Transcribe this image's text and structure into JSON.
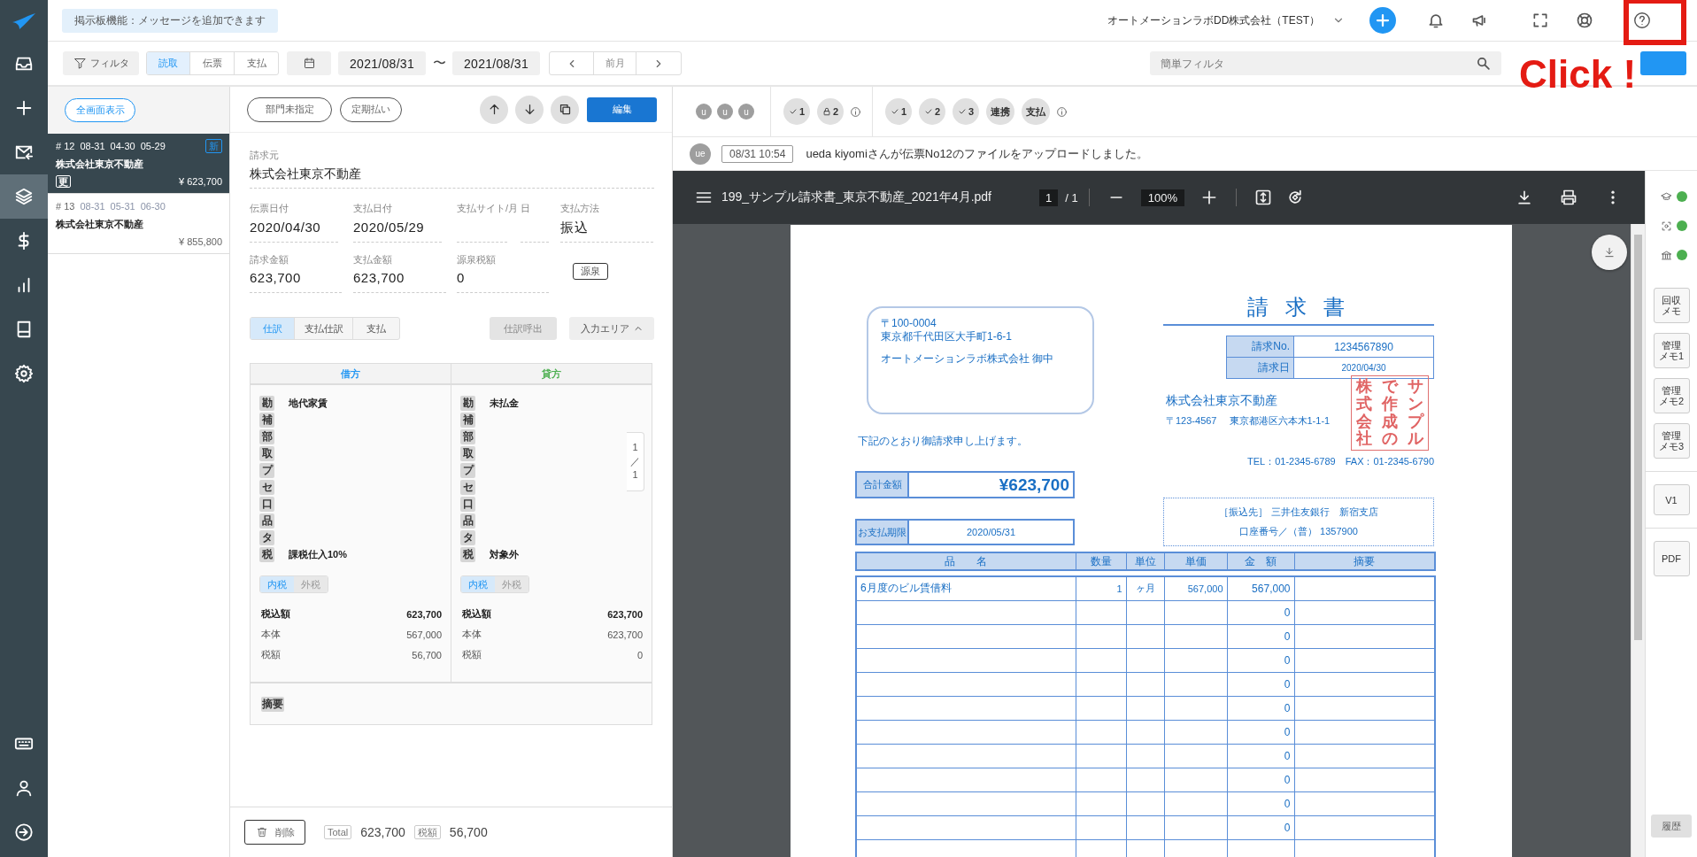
{
  "nav": {
    "top": [
      {
        "kind": "inbox",
        "selected": false
      },
      {
        "kind": "add",
        "selected": false
      },
      {
        "kind": "mail",
        "selected": false
      },
      {
        "kind": "layers",
        "selected": true
      },
      {
        "kind": "money",
        "selected": false
      },
      {
        "kind": "chart",
        "selected": false
      },
      {
        "kind": "book",
        "selected": false
      },
      {
        "kind": "settings",
        "selected": false
      }
    ],
    "bottom": [
      {
        "kind": "keyboard",
        "selected": false
      },
      {
        "kind": "user",
        "selected": false
      },
      {
        "kind": "logout",
        "selected": false
      }
    ]
  },
  "topbar": {
    "notice": "掲示板機能：メッセージを追加できます",
    "company": "オートメーションラボDD株式会社（TEST）"
  },
  "toolbar": {
    "filter": "フィルタ",
    "modes": [
      {
        "label": "読取",
        "selected": true
      },
      {
        "label": "伝票",
        "selected": false
      },
      {
        "label": "支払",
        "selected": false
      }
    ],
    "date_from": "2021/08/31",
    "range_separator": "〜",
    "date_to": "2021/08/31",
    "period": "前月",
    "quick_filter": {
      "placeholder": "簡単フィルタ"
    }
  },
  "annotation": {
    "text": "Click !"
  },
  "list": {
    "fullscreen": "全画面表示",
    "items": [
      {
        "number": "# 12",
        "dates": [
          "08-31",
          "04-30",
          "05-29"
        ],
        "badge": "新",
        "name": "株式会社東京不動産",
        "tag": "更",
        "amount": "¥ 623,700",
        "selected": true
      },
      {
        "number": "# 13",
        "dates": [
          "08-31",
          "05-31",
          "06-30"
        ],
        "name": "株式会社東京不動産",
        "amount": "¥ 855,800",
        "selected": false
      }
    ]
  },
  "form": {
    "chips": [
      "部門未指定",
      "定期払い"
    ],
    "edit": "編集",
    "vendor": {
      "label": "請求元",
      "value": "株式会社東京不動産"
    },
    "dates": [
      {
        "label": "伝票日付",
        "value": "2020/04/30"
      },
      {
        "label": "支払日付",
        "value": "2020/05/29"
      },
      {
        "label": "支払サイト/月"
      },
      {
        "label": "日"
      },
      {
        "label": "支払方法",
        "value": "振込"
      }
    ],
    "amounts": [
      {
        "label": "請求金額",
        "value": "623,700"
      },
      {
        "label": "支払金額",
        "value": "623,700"
      },
      {
        "label": "源泉税額",
        "value": "0"
      }
    ],
    "withholding": "源泉",
    "tabs": [
      {
        "label": "仕訳",
        "selected": true
      },
      {
        "label": "支払仕訳",
        "selected": false
      },
      {
        "label": "支払",
        "selected": false
      }
    ],
    "recall": {
      "label": "仕訳呼出",
      "disabled": true
    },
    "input_area": "入力エリア",
    "journal": {
      "sides": [
        {
          "title": "借方",
          "color": "#2196f3",
          "lines": [
            {
              "tag": "勘",
              "value": "地代家賃"
            },
            {
              "tag": "補"
            },
            {
              "tag": "部"
            },
            {
              "tag": "取"
            },
            {
              "tag": "プ"
            },
            {
              "tag": "セ"
            },
            {
              "tag": "口"
            },
            {
              "tag": "品"
            },
            {
              "tag": "タ"
            },
            {
              "tag": "税",
              "value": "課税仕入10%"
            }
          ],
          "tax_modes": [
            {
              "label": "内税",
              "selected": true
            },
            {
              "label": "外税",
              "selected": false
            }
          ],
          "totals": [
            {
              "label": "税込額",
              "value": "623,700"
            },
            {
              "label": "本体",
              "value": "567,000"
            },
            {
              "label": "税額",
              "value": "56,700"
            }
          ]
        },
        {
          "title": "貸方",
          "color": "#4caf50",
          "lines": [
            {
              "tag": "勘",
              "value": "未払金"
            },
            {
              "tag": "補"
            },
            {
              "tag": "部"
            },
            {
              "tag": "取"
            },
            {
              "tag": "プ"
            },
            {
              "tag": "セ"
            },
            {
              "tag": "口"
            },
            {
              "tag": "品"
            },
            {
              "tag": "タ"
            },
            {
              "tag": "税",
              "value": "対象外"
            }
          ],
          "tax_modes": [
            {
              "label": "内税",
              "selected": true
            },
            {
              "label": "外税",
              "selected": false
            }
          ],
          "totals": [
            {
              "label": "税込額",
              "value": "623,700"
            },
            {
              "label": "本体",
              "value": "623,700"
            },
            {
              "label": "税額",
              "value": "0"
            }
          ]
        }
      ],
      "pager": "1／1",
      "memo_tag": "摘要"
    },
    "footer": {
      "delete": "削除",
      "total_label": "Total",
      "total": "623,700",
      "tax_label": "税額",
      "tax": "56,700"
    }
  },
  "activity": {
    "users": [
      "u",
      "u",
      "u"
    ],
    "approvals": [
      {
        "kind": "check",
        "label": "1"
      },
      {
        "kind": "lock",
        "label": "2"
      }
    ],
    "steps": [
      {
        "kind": "check",
        "label": "1"
      },
      {
        "kind": "check",
        "label": "2"
      },
      {
        "kind": "check",
        "label": "3"
      },
      {
        "kind": "text",
        "label": "連携"
      },
      {
        "kind": "text",
        "label": "支払"
      }
    ],
    "message": {
      "avatar": "ue",
      "time": "08/31 10:54",
      "text": "ueda kiyomiさんが伝票No12のファイルをアップロードしました。"
    }
  },
  "pdf": {
    "file": "199_サンプル請求書_東京不動産_2021年4月.pdf",
    "page": "1",
    "pages": "/ 1",
    "zoom": "100%"
  },
  "invoice": {
    "address": [
      "〒100-0004",
      "東京都千代田区大手町1-6-1",
      "オートメーションラボ株式会社 御中"
    ],
    "title": "請 求 書",
    "meta": [
      {
        "label": "請求No.",
        "value": "1234567890"
      },
      {
        "label": "請求日",
        "value": "2020/04/30"
      }
    ],
    "issuer": "株式会社東京不動産",
    "issuer_zip": "〒123-4567",
    "issuer_address": "東京都港区六本木1-1-1",
    "stamp": [
      "株式会社",
      "で作成の",
      "サンプル"
    ],
    "phone": "TEL：01-2345-6789　FAX：01-2345-6790",
    "greeting": "下記のとおり御請求申し上げます。",
    "total_label": "合計金額",
    "total": "¥623,700",
    "due_label": "お支払期限",
    "due": "2020/05/31",
    "bank": [
      "［振込先］ 三井住友銀行　新宿支店",
      "口座番号／（普） 1357900"
    ],
    "columns": [
      "品　　名",
      "数量",
      "単位",
      "単価",
      "金　額",
      "摘要"
    ],
    "rows": [
      {
        "item": "6月度のビル賃借料",
        "qty": "1",
        "unit": "ヶ月",
        "price": "567,000",
        "amount": "567,000"
      },
      {
        "amount": "0"
      },
      {
        "amount": "0"
      },
      {
        "amount": "0"
      },
      {
        "amount": "0"
      },
      {
        "amount": "0"
      },
      {
        "amount": "0"
      },
      {
        "amount": "0"
      },
      {
        "amount": "0"
      },
      {
        "amount": "0"
      },
      {
        "amount": "0"
      }
    ]
  },
  "rail": {
    "status": [
      {
        "kind": "cap",
        "on": true
      },
      {
        "kind": "scan",
        "on": true
      },
      {
        "kind": "bank",
        "on": true
      }
    ],
    "memos": [
      {
        "lines": [
          "回収",
          "メモ"
        ]
      },
      {
        "lines": [
          "管理",
          "メモ1"
        ]
      },
      {
        "lines": [
          "管理",
          "メモ2"
        ]
      },
      {
        "lines": [
          "管理",
          "メモ3"
        ]
      }
    ],
    "version": "V1",
    "pdf": "PDF",
    "history": "履歴"
  }
}
